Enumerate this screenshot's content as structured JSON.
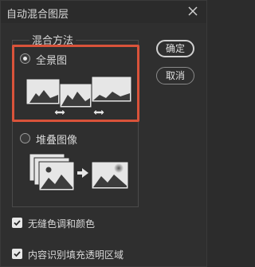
{
  "dialog": {
    "title": "自动混合图层",
    "close_icon": "close-icon"
  },
  "method_group": {
    "label": "混合方法",
    "options": [
      {
        "label": "全景图",
        "selected": true,
        "icon": "panorama-illustration"
      },
      {
        "label": "堆叠图像",
        "selected": false,
        "icon": "stack-images-illustration"
      }
    ]
  },
  "buttons": {
    "ok": "确定",
    "cancel": "取消"
  },
  "checkboxes": [
    {
      "label": "无缝色调和颜色",
      "checked": true
    },
    {
      "label": "内容识别填充透明区域",
      "checked": true
    }
  ],
  "colors": {
    "background": "#2f2f2f",
    "highlight": "#d9533a",
    "text": "#d8d8d8"
  }
}
